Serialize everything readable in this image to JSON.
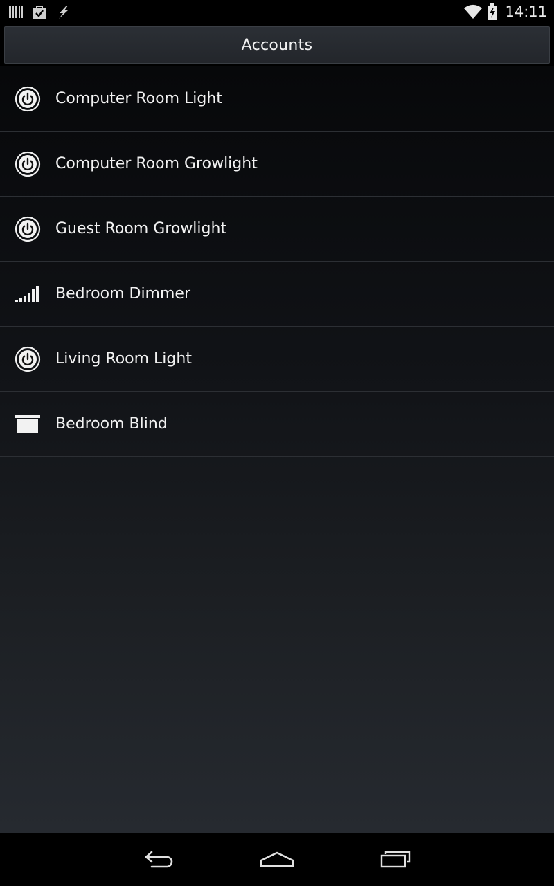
{
  "status_bar": {
    "time": "14:11",
    "left_icons": [
      "barcode-icon",
      "shopping-bag-check-icon",
      "lightning-icon"
    ],
    "right_icons": [
      "wifi-icon",
      "battery-charging-icon"
    ]
  },
  "title_bar": {
    "title": "Accounts"
  },
  "list": {
    "items": [
      {
        "label": "Computer Room Light",
        "icon": "power-icon"
      },
      {
        "label": "Computer Room Growlight",
        "icon": "power-icon"
      },
      {
        "label": "Guest Room Growlight",
        "icon": "power-icon"
      },
      {
        "label": "Bedroom Dimmer",
        "icon": "dimmer-bars-icon"
      },
      {
        "label": "Living Room Light",
        "icon": "power-icon"
      },
      {
        "label": "Bedroom Blind",
        "icon": "blind-icon"
      }
    ]
  },
  "nav_bar": {
    "buttons": [
      "back-icon",
      "home-icon",
      "recent-apps-icon"
    ]
  },
  "colors": {
    "text": "#f2f2f2",
    "divider": "#2c2f34",
    "title_bar_bg": "#2b2f35"
  }
}
